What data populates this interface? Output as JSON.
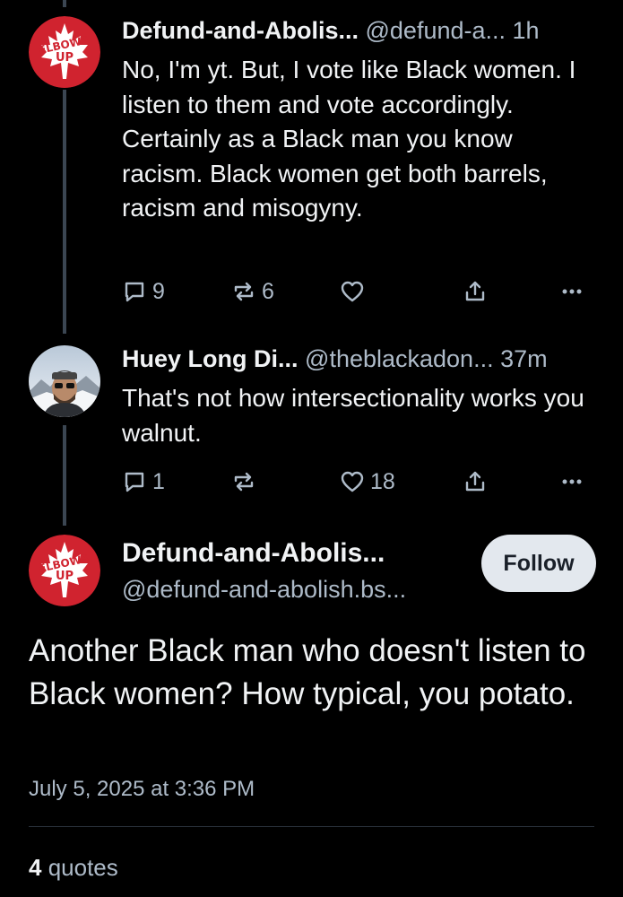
{
  "thread": {
    "posts": [
      {
        "author_name": "Defund-and-Abolis...",
        "author_handle": "@defund-a...",
        "time": "1h",
        "avatar_icon": "elbows-up-maple-leaf-icon",
        "avatar_text": "ELBOWS UP",
        "text": "No, I'm yt. But, I vote like Black women. I listen to them and vote accordingly. Certainly as a Black man you know racism. Black women get both barrels, racism and misogyny.",
        "replies": "9",
        "reposts": "6",
        "likes": ""
      },
      {
        "author_name": "Huey Long Di...",
        "author_handle": "@theblackadon...",
        "time": "37m",
        "avatar_icon": "profile-photo-icon",
        "text": "That's not how intersectionality works you walnut.",
        "replies": "1",
        "reposts": "",
        "likes": "18"
      }
    ]
  },
  "main_post": {
    "author_name": "Defund-and-Abolis...",
    "author_handle": "@defund-and-abolish.bs...",
    "follow_label": "Follow",
    "text": "Another Black man who doesn't listen to Black women? How typical, you potato.",
    "timestamp": "July 5, 2025 at 3:36 PM",
    "quotes_count": "4",
    "quotes_label": "quotes"
  },
  "colors": {
    "background": "#000000",
    "text_primary": "#f1f3f5",
    "text_secondary": "#aebbc9",
    "thread_line": "#3b4652",
    "follow_bg": "#e3e8ee",
    "avatar_red": "#d0232f"
  }
}
